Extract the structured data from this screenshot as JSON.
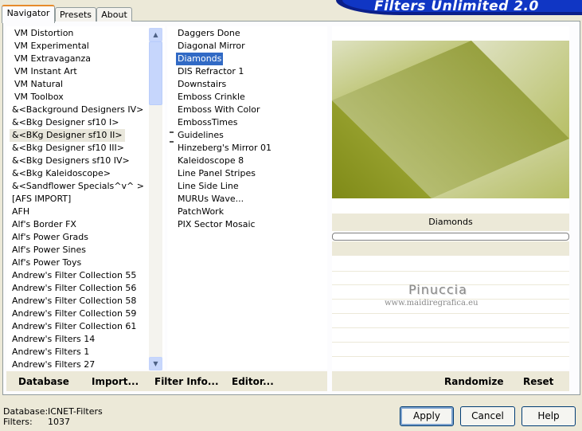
{
  "header": {
    "title": "Filters Unlimited 2.0"
  },
  "tabs": [
    {
      "label": "Navigator",
      "active": true
    },
    {
      "label": "Presets",
      "active": false
    },
    {
      "label": "About",
      "active": false
    }
  ],
  "categories": [
    "VM Distortion",
    "VM Experimental",
    "VM Extravaganza",
    "VM Instant Art",
    "VM Natural",
    "VM Toolbox",
    "&<Background Designers IV>",
    "&<Bkg Designer sf10 I>",
    "&<BKg Designer sf10 II>",
    "&<Bkg Designer sf10 III>",
    "&<Bkg Designers sf10 IV>",
    "&<Bkg Kaleidoscope>",
    "&<Sandflower Specials^v^ >",
    "[AFS IMPORT]",
    "AFH",
    "Alf's Border FX",
    "Alf's Power Grads",
    "Alf's Power Sines",
    "Alf's Power Toys",
    "Andrew's Filter Collection 55",
    "Andrew's Filter Collection 56",
    "Andrew's Filter Collection 58",
    "Andrew's Filter Collection 59",
    "Andrew's Filter Collection 61",
    "Andrew's Filters 14",
    "Andrew's Filters 1",
    "Andrew's Filters 27"
  ],
  "selected_category": "&<BKg Designer sf10 II>",
  "filters": [
    "Daggers Done",
    "Diagonal Mirror",
    "Diamonds",
    "DIS Refractor 1",
    "Downstairs",
    "Emboss Crinkle",
    "Emboss With Color",
    "EmbossTimes",
    "Guidelines",
    "Hinzeberg's Mirror 01",
    "Kaleidoscope 8",
    "Line Panel Stripes",
    "Line Side Line",
    "MURUs Wave...",
    "PatchWork",
    "PIX Sector Mosaic"
  ],
  "selected_filter": "Diamonds",
  "preview": {
    "label": "Diamonds",
    "colors": {
      "light": "#d4d8b2",
      "mid": "#a4ae3a",
      "dark": "#7f8a17"
    }
  },
  "watermark": {
    "name": "Pinuccia",
    "site": "www.maidiregrafica.eu"
  },
  "toolbar": {
    "database": "Database",
    "import": "Import...",
    "filter_info": "Filter Info...",
    "editor": "Editor...",
    "randomize": "Randomize",
    "reset": "Reset"
  },
  "status": {
    "database_label": "Database:",
    "database_value": "ICNET-Filters",
    "filters_label": "Filters:",
    "filters_value": "1037"
  },
  "buttons": {
    "apply": "Apply",
    "cancel": "Cancel",
    "help": "Help"
  }
}
